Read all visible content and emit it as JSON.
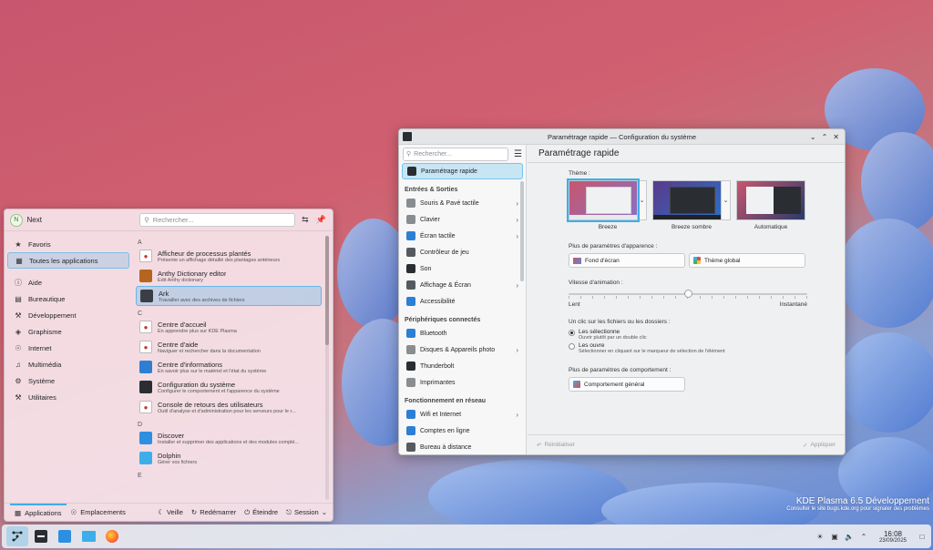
{
  "launcher": {
    "user_name": "Next",
    "avatar_letter": "N",
    "search_placeholder": "Rechercher...",
    "categories": [
      {
        "label": "Favoris",
        "icon": "bookmark-icon"
      },
      {
        "label": "Toutes les applications",
        "icon": "grid-icon",
        "selected": true
      },
      {
        "label": "Aide",
        "icon": "help-icon"
      },
      {
        "label": "Bureautique",
        "icon": "office-icon"
      },
      {
        "label": "Développement",
        "icon": "development-icon"
      },
      {
        "label": "Graphisme",
        "icon": "graphics-icon"
      },
      {
        "label": "Internet",
        "icon": "globe-icon"
      },
      {
        "label": "Multimédia",
        "icon": "multimedia-icon"
      },
      {
        "label": "Système",
        "icon": "system-icon"
      },
      {
        "label": "Utilitaires",
        "icon": "utilities-icon"
      }
    ],
    "sections": [
      {
        "letter": "A",
        "apps": [
          {
            "name": "Afficheur de processus plantés",
            "desc": "Présente un affichage détaillé des plantages antérieurs",
            "icon": "crash-icon",
            "color": "#ffffff"
          },
          {
            "name": "Anthy Dictionary editor",
            "desc": "Edit Anthy dictionary",
            "icon": "book-icon",
            "color": "#b5651d"
          },
          {
            "name": "Ark",
            "desc": "Travailler avec des archives de fichiers",
            "icon": "archive-icon",
            "color": "#3a3f45",
            "selected": true
          }
        ]
      },
      {
        "letter": "C",
        "apps": [
          {
            "name": "Centre d'accueil",
            "desc": "En apprendre plus sur KDE Plasma",
            "icon": "welcome-icon",
            "color": "#ffffff"
          },
          {
            "name": "Centre d'aide",
            "desc": "Naviguer et rechercher dans la documentation",
            "icon": "lifebuoy-icon",
            "color": "#ffffff"
          },
          {
            "name": "Centre d'informations",
            "desc": "En savoir plus sur le matériel et l'état du système",
            "icon": "info-icon",
            "color": "#2d7fd4"
          },
          {
            "name": "Configuration du système",
            "desc": "Configurer le comportement et l'apparence du système",
            "icon": "settings-icon",
            "color": "#2a2e32"
          },
          {
            "name": "Console de retours des utilisateurs",
            "desc": "Outil d'analyse et d'administration pour les serveurs pour le r...",
            "icon": "magnifier-icon",
            "color": "#ffffff"
          }
        ]
      },
      {
        "letter": "D",
        "apps": [
          {
            "name": "Discover",
            "desc": "Installer et supprimer des applications et des modules complé...",
            "icon": "discover-icon",
            "color": "#2d8fdf"
          },
          {
            "name": "Dolphin",
            "desc": "Gérer vos fichiers",
            "icon": "folder-icon",
            "color": "#3daee9"
          }
        ]
      },
      {
        "letter": "E",
        "apps": []
      }
    ],
    "bottom": {
      "applications": "Applications",
      "places": "Emplacements",
      "sleep": "Veille",
      "restart": "Redémarrer",
      "shutdown": "Éteindre",
      "session": "Session"
    }
  },
  "settings": {
    "window_title": "Paramétrage rapide — Configuration du système",
    "search_placeholder": "Rechercher...",
    "page_title": "Paramétrage rapide",
    "sidebar": [
      {
        "type": "item",
        "label": "Paramétrage rapide",
        "icon": "quick-settings-icon",
        "color": "#2a2e32",
        "selected": true
      },
      {
        "type": "section",
        "label": "Entrées & Sorties"
      },
      {
        "type": "item",
        "label": "Souris & Pavé tactile",
        "icon": "mouse-icon",
        "color": "#8a8d90",
        "chevron": true
      },
      {
        "type": "item",
        "label": "Clavier",
        "icon": "keyboard-icon",
        "color": "#8a8d90",
        "chevron": true
      },
      {
        "type": "item",
        "label": "Écran tactile",
        "icon": "touchscreen-icon",
        "color": "#2d7fd4",
        "chevron": true
      },
      {
        "type": "item",
        "label": "Contrôleur de jeu",
        "icon": "gamepad-icon",
        "color": "#555a60"
      },
      {
        "type": "item",
        "label": "Son",
        "icon": "speaker-icon",
        "color": "#2a2e32"
      },
      {
        "type": "item",
        "label": "Affichage & Écran",
        "icon": "display-icon",
        "color": "#555a60",
        "chevron": true
      },
      {
        "type": "item",
        "label": "Accessibilité",
        "icon": "accessibility-icon",
        "color": "#2d7fd4"
      },
      {
        "type": "section",
        "label": "Périphériques connectés"
      },
      {
        "type": "item",
        "label": "Bluetooth",
        "icon": "bluetooth-icon",
        "color": "#2d7fd4"
      },
      {
        "type": "item",
        "label": "Disques & Appareils photo",
        "icon": "disk-icon",
        "color": "#8a8d90",
        "chevron": true
      },
      {
        "type": "item",
        "label": "Thunderbolt",
        "icon": "thunderbolt-icon",
        "color": "#2a2e32"
      },
      {
        "type": "item",
        "label": "Imprimantes",
        "icon": "printer-icon",
        "color": "#8a8d90"
      },
      {
        "type": "section",
        "label": "Fonctionnement en réseau"
      },
      {
        "type": "item",
        "label": "Wifi et Internet",
        "icon": "network-icon",
        "color": "#2d7fd4",
        "chevron": true
      },
      {
        "type": "item",
        "label": "Comptes en ligne",
        "icon": "accounts-icon",
        "color": "#2d7fd4"
      },
      {
        "type": "item",
        "label": "Bureau à distance",
        "icon": "remote-desktop-icon",
        "color": "#555a60"
      }
    ],
    "theme_label": "Thème :",
    "themes": [
      {
        "name": "Breeze",
        "selected": true,
        "style": "light"
      },
      {
        "name": "Breeze sombre",
        "selected": false,
        "style": "dark"
      },
      {
        "name": "Automatique",
        "selected": false,
        "style": "auto"
      }
    ],
    "appearance_label": "Plus de paramètres d'apparence :",
    "wallpaper_btn": "Fond d'écran",
    "global_theme_btn": "Thème global",
    "animation_label": "Vitesse d'animation :",
    "animation_value": 0.5,
    "animation_min": "Lent",
    "animation_max": "Instantané",
    "click_label": "Un clic sur les fichiers ou les dossiers :",
    "click_options": [
      {
        "label": "Les sélectionne",
        "sub": "Ouvrir plutôt par un double clic",
        "checked": true
      },
      {
        "label": "Les ouvre",
        "sub": "Sélectionner en cliquant sur le marqueur de sélection de l'élément",
        "checked": false
      }
    ],
    "behavior_label": "Plus de paramètres de comportement :",
    "behavior_btn": "Comportement général",
    "reset_btn": "Réinitialiser",
    "apply_btn": "Appliquer"
  },
  "watermark": {
    "title": "KDE Plasma 6.5 Développement",
    "subtitle": "Consulter le site bugs.kde.org pour signaler des problèmes"
  },
  "taskbar": {
    "time": "16:08",
    "date": "23/09/2025"
  },
  "colors": {
    "accent": "#3daee9"
  }
}
